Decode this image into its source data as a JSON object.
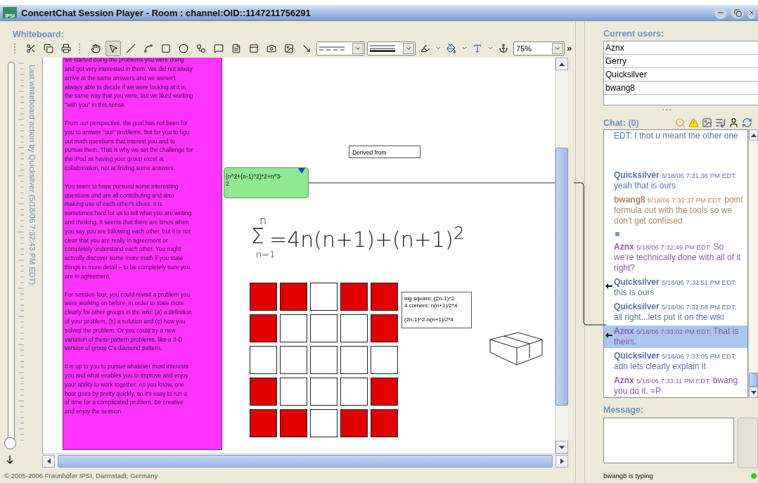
{
  "window": {
    "logo": "IPSI",
    "title": "ConcertChat Session Player - Room : channel:OID::1147211756291"
  },
  "whiteboard": {
    "label": "Whiteboard:",
    "tools": [
      {
        "selected": false
      },
      {
        "selected": true
      },
      {
        "selected": false
      },
      {
        "selected": false
      },
      {
        "selected": false
      },
      {
        "selected": false
      },
      {
        "selected": false
      },
      {
        "selected": false
      },
      {
        "selected": false
      },
      {
        "selected": false
      },
      {
        "selected": false
      },
      {
        "selected": false
      },
      {
        "selected": false
      }
    ],
    "zoom": "75%",
    "more": "»",
    "history": {
      "caption": "Last whiteboard action by Quicksilver (5/18/06 7:32:43 PM EDT)",
      "level": 0
    },
    "note": [
      "we started doing the problems you were doing\nand got very interested in them. We did not alway\narrive at the same answers and we weren't\nalways able to decide if we were looking at it in\nthe same way that you were, but we liked working\n\"with you\" in this sense.",
      "From our perspective, the goal has not been for\nyou to answer \"our\" problems, but for you to figu\nout math questions that interest you and to\npursue them. That is why we set the challenge for\nthe iPod as having your group excel at\ncollaboration, not at finding some answers.",
      "You seem to have pursued some interesting\nquestions and are all contributing and also\nmaking use of each other's ideas. It is\nsometimes hard for us to tell what you are writing\nand thinking. It seems that there are times when\nyou say you are following each other, but it is not\nclear that you are really in agreement or\ncompletely understand each other. You might\nactually discover some more math if you state\nthings in more detail – to be completely sure you\nare in agreement.",
      "For session four, you could revisit a problem you\nwere working on before, in order to state more\nclearly for other groups in the wiki: (a) a definition\nof your problem, (b) a solution and (c) how you\nsolved the problem. Or you could try a new\nvariation of these pattern problems, like a 3-D\nversion of group C's diamond pattern.",
      "It is up to you to pursue whatever most interests\nyou and what enables you to improve and enjoy\nyour ability to work together. As you know, one\nhour goes by pretty quickly, so it's easy to run o\nof time for a complicated problem. Be creative\nand enjoy the session."
    ],
    "label_box": "Derived from",
    "formula_box": "(n^2+(n-1)^2)*2+n^3-\n2",
    "handwriting": {
      "upper": "n",
      "sigma": "Σ",
      "lower": "n=1",
      "sum": "=4n(n+1)+(n+1)$^{2}$"
    },
    "squares": [
      [
        {
          "filled": true
        },
        {
          "filled": true
        },
        {
          "filled": false
        },
        {
          "filled": true
        },
        {
          "filled": true
        }
      ],
      [
        {
          "filled": true
        },
        {
          "filled": false
        },
        {
          "filled": false
        },
        {
          "filled": false
        },
        {
          "filled": true
        }
      ],
      [
        {
          "filled": false
        },
        {
          "filled": false
        },
        {
          "filled": false
        },
        {
          "filled": false
        },
        {
          "filled": false
        }
      ],
      [
        {
          "filled": true
        },
        {
          "filled": false
        },
        {
          "filled": false
        },
        {
          "filled": false
        },
        {
          "filled": true
        }
      ],
      [
        {
          "filled": true
        },
        {
          "filled": true
        },
        {
          "filled": false
        },
        {
          "filled": true
        },
        {
          "filled": true
        }
      ]
    ],
    "calc_note": [
      "big square: (2n-1)^2",
      "4 corners: n(n+1)/2*4",
      "(2n-1)^2-n(n+1)/2*4"
    ],
    "copyright": "© 2005-2006 Fraunhofer IPSI, Darmstadt, Germany"
  },
  "users": {
    "label": "Current users:",
    "items": [
      "Aznx",
      "Gerry",
      "Quicksilver",
      "bwang8"
    ]
  },
  "chat": {
    "label": "Chat: (0)",
    "messages": [
      {
        "kind": "fragment",
        "text": "EDT: I thot u meant the other one",
        "color": "#5b73a9"
      },
      {
        "kind": "message",
        "author": "Quicksilver",
        "time": "5/18/06 7:31:36 PM EDT:",
        "text": "yeah that is ours",
        "color": "#5b73a9",
        "linked": false,
        "selected": false
      },
      {
        "kind": "message",
        "author": "bwang8",
        "time": "5/18/06 7:32:37 PM EDT:",
        "text": "point formula out with the tools so we don't get confused",
        "color": "#b08763",
        "linked": false,
        "selected": false
      },
      {
        "kind": "marker",
        "color": "#7d96cf"
      },
      {
        "kind": "message",
        "author": "Aznx",
        "time": "5/18/06 7:32:49 PM EDT:",
        "text": "So we're technically done with all of it right?",
        "color": "#8a5ab0",
        "linked": false,
        "selected": false
      },
      {
        "kind": "message",
        "author": "Quicksilver",
        "time": "5/18/06 7:32:51 PM EDT:",
        "text": "this is ours",
        "color": "#5b73a9",
        "linked": true,
        "selected": false
      },
      {
        "kind": "message",
        "author": "Quicksilver",
        "time": "5/18/06 7:32:58 PM EDT:",
        "text": "all right...lets put it on the wiki",
        "color": "#5b73a9",
        "linked": false,
        "selected": false
      },
      {
        "kind": "message",
        "author": "Aznx",
        "time": "5/18/06 7:33:02 PM EDT:",
        "text": "That is theirs.",
        "color": "#8a5ab0",
        "linked": true,
        "selected": true
      },
      {
        "kind": "message",
        "author": "Quicksilver",
        "time": "5/18/06 7:33:05 PM EDT:",
        "text": "adn lets clearly explain it",
        "color": "#5b73a9",
        "linked": false,
        "selected": false
      },
      {
        "kind": "message",
        "author": "Aznx",
        "time": "5/18/06 7:33:11 PM EDT:",
        "text": "bwang you do it. =P",
        "color": "#8a5ab0",
        "linked": false,
        "selected": false
      }
    ]
  },
  "message": {
    "label": "Message:"
  },
  "status": "bwang8 is typing"
}
